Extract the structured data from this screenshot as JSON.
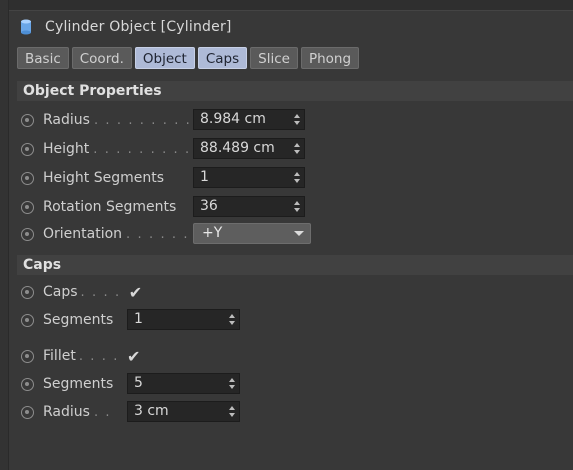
{
  "header": {
    "title": "Cylinder Object [Cylinder]",
    "icon": "cylinder-icon"
  },
  "tabs": [
    {
      "label": "Basic",
      "active": false
    },
    {
      "label": "Coord.",
      "active": false
    },
    {
      "label": "Object",
      "active": true
    },
    {
      "label": "Caps",
      "active": true
    },
    {
      "label": "Slice",
      "active": false
    },
    {
      "label": "Phong",
      "active": false
    }
  ],
  "object_properties": {
    "heading": "Object Properties",
    "radius": {
      "label": "Radius",
      "dots": ". . . . . . . . .",
      "value": "8.984 cm"
    },
    "height": {
      "label": "Height",
      "dots": ". . . . . . . . .",
      "value": "88.489 cm"
    },
    "height_segments": {
      "label": "Height Segments",
      "value": "1"
    },
    "rotation_segments": {
      "label": "Rotation Segments",
      "value": "36"
    },
    "orientation": {
      "label": "Orientation",
      "dots": ". . . . . . .",
      "value": "+Y"
    }
  },
  "caps": {
    "heading": "Caps",
    "caps": {
      "label": "Caps",
      "dots": ". . . .",
      "checked": "✔"
    },
    "segments": {
      "label": "Segments",
      "value": "1"
    },
    "fillet": {
      "label": "Fillet",
      "dots": ". . . .",
      "checked": "✔"
    },
    "fillet_segments": {
      "label": "Segments",
      "value": "5"
    },
    "fillet_radius": {
      "label": "Radius",
      "dots": ". .",
      "value": "3 cm"
    }
  },
  "colors": {
    "background": "#383838",
    "active_tab": "#aebad7",
    "field": "#262626"
  }
}
